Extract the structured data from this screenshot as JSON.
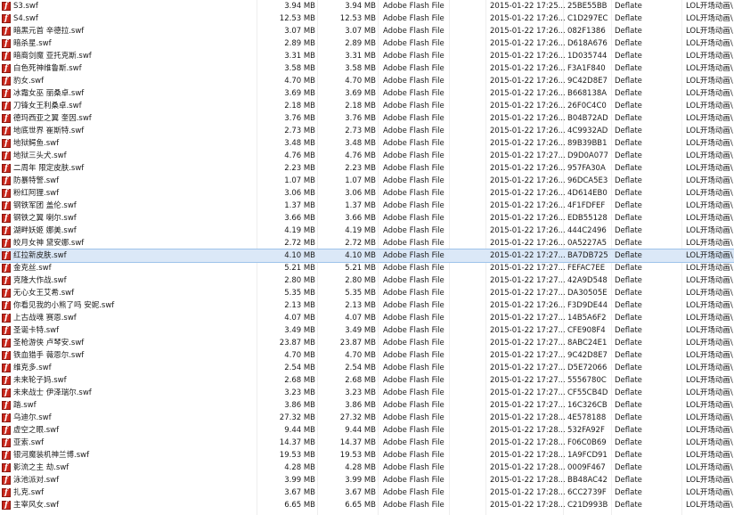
{
  "file_type": "Adobe Flash File",
  "method": "Deflate",
  "folder": "LOL开场动画\\",
  "selected_index": 20,
  "files": [
    {
      "name": "S3.swf",
      "size": "3.94 MB",
      "packed": "3.94 MB",
      "modified": "2015-01-22 17:25...",
      "crc": "25BE55BB"
    },
    {
      "name": "S4.swf",
      "size": "12.53 MB",
      "packed": "12.53 MB",
      "modified": "2015-01-22 17:26...",
      "crc": "C1D297EC"
    },
    {
      "name": "暗黑元首 辛德拉.swf",
      "size": "3.07 MB",
      "packed": "3.07 MB",
      "modified": "2015-01-22 17:26...",
      "crc": "082F1386"
    },
    {
      "name": "暗杀星.swf",
      "size": "2.89 MB",
      "packed": "2.89 MB",
      "modified": "2015-01-22 17:26...",
      "crc": "D618A676"
    },
    {
      "name": "暗裔剑魔 亚托克斯.swf",
      "size": "3.31 MB",
      "packed": "3.31 MB",
      "modified": "2015-01-22 17:26...",
      "crc": "1D035744"
    },
    {
      "name": "白色死神维鲁斯.swf",
      "size": "3.58 MB",
      "packed": "3.58 MB",
      "modified": "2015-01-22 17:26...",
      "crc": "F3A1F840"
    },
    {
      "name": "豹女.swf",
      "size": "4.70 MB",
      "packed": "4.70 MB",
      "modified": "2015-01-22 17:26...",
      "crc": "9C42D8E7"
    },
    {
      "name": "冰霜女巫 丽桑卓.swf",
      "size": "3.69 MB",
      "packed": "3.69 MB",
      "modified": "2015-01-22 17:26...",
      "crc": "B668138A"
    },
    {
      "name": "刀锋女王利桑卓.swf",
      "size": "2.18 MB",
      "packed": "2.18 MB",
      "modified": "2015-01-22 17:26...",
      "crc": "26F0C4C0"
    },
    {
      "name": "德玛西亚之翼 奎因.swf",
      "size": "3.76 MB",
      "packed": "3.76 MB",
      "modified": "2015-01-22 17:26...",
      "crc": "B04B72AD"
    },
    {
      "name": "地底世界 崔斯特.swf",
      "size": "2.73 MB",
      "packed": "2.73 MB",
      "modified": "2015-01-22 17:26...",
      "crc": "4C9932AD"
    },
    {
      "name": "地狱鳄鱼.swf",
      "size": "3.48 MB",
      "packed": "3.48 MB",
      "modified": "2015-01-22 17:26...",
      "crc": "89B39BB1"
    },
    {
      "name": "地狱三头犬.swf",
      "size": "4.76 MB",
      "packed": "4.76 MB",
      "modified": "2015-01-22 17:27...",
      "crc": "D9D0A077"
    },
    {
      "name": "二周年 限定皮肤.swf",
      "size": "2.23 MB",
      "packed": "2.23 MB",
      "modified": "2015-01-22 17:26...",
      "crc": "957FA30A"
    },
    {
      "name": "防暴特警.swf",
      "size": "1.07 MB",
      "packed": "1.07 MB",
      "modified": "2015-01-22 17:26...",
      "crc": "96DCA5E3"
    },
    {
      "name": "粉红阿狸.swf",
      "size": "3.06 MB",
      "packed": "3.06 MB",
      "modified": "2015-01-22 17:26...",
      "crc": "4D614EB0"
    },
    {
      "name": "钢铁军团 盖伦.swf",
      "size": "1.37 MB",
      "packed": "1.37 MB",
      "modified": "2015-01-22 17:26...",
      "crc": "4F1FDFEF"
    },
    {
      "name": "钢铁之翼 喇尔.swf",
      "size": "3.66 MB",
      "packed": "3.66 MB",
      "modified": "2015-01-22 17:26...",
      "crc": "EDB55128"
    },
    {
      "name": "湖畔妖姬 娜美.swf",
      "size": "4.19 MB",
      "packed": "4.19 MB",
      "modified": "2015-01-22 17:26...",
      "crc": "444C2496"
    },
    {
      "name": "皎月女神 黛安娜.swf",
      "size": "2.72 MB",
      "packed": "2.72 MB",
      "modified": "2015-01-22 17:26...",
      "crc": "0A5227A5"
    },
    {
      "name": "红拉新皮肤.swf",
      "size": "4.10 MB",
      "packed": "4.10 MB",
      "modified": "2015-01-22 17:27...",
      "crc": "BA7DB725"
    },
    {
      "name": "金克丝.swf",
      "size": "5.21 MB",
      "packed": "5.21 MB",
      "modified": "2015-01-22 17:27...",
      "crc": "FEFAC7EE"
    },
    {
      "name": "克隆大作战.swf",
      "size": "2.80 MB",
      "packed": "2.80 MB",
      "modified": "2015-01-22 17:27...",
      "crc": "42A9D548"
    },
    {
      "name": "无心女王艾希.swf",
      "size": "5.35 MB",
      "packed": "5.35 MB",
      "modified": "2015-01-22 17:27...",
      "crc": "DA30505E"
    },
    {
      "name": "你看见我的小熊了吗 安妮.swf",
      "size": "2.13 MB",
      "packed": "2.13 MB",
      "modified": "2015-01-22 17:26...",
      "crc": "F3D9DE44"
    },
    {
      "name": "上古战魂 赛恩.swf",
      "size": "4.07 MB",
      "packed": "4.07 MB",
      "modified": "2015-01-22 17:27...",
      "crc": "14B5A6F2"
    },
    {
      "name": "圣诞卡特.swf",
      "size": "3.49 MB",
      "packed": "3.49 MB",
      "modified": "2015-01-22 17:27...",
      "crc": "CFE908F4"
    },
    {
      "name": "圣枪游侠 卢琴安.swf",
      "size": "23.87 MB",
      "packed": "23.87 MB",
      "modified": "2015-01-22 17:27...",
      "crc": "8ABC24E1"
    },
    {
      "name": "铁血猎手 薇恩尔.swf",
      "size": "4.70 MB",
      "packed": "4.70 MB",
      "modified": "2015-01-22 17:27...",
      "crc": "9C42D8E7"
    },
    {
      "name": "维克多.swf",
      "size": "2.54 MB",
      "packed": "2.54 MB",
      "modified": "2015-01-22 17:27...",
      "crc": "D5E72066"
    },
    {
      "name": "未来轮子妈.swf",
      "size": "2.68 MB",
      "packed": "2.68 MB",
      "modified": "2015-01-22 17:27...",
      "crc": "5556780C"
    },
    {
      "name": "未来战士 伊泽瑞尔.swf",
      "size": "3.23 MB",
      "packed": "3.23 MB",
      "modified": "2015-01-22 17:27...",
      "crc": "CF55CB4D"
    },
    {
      "name": "踏.swf",
      "size": "3.86 MB",
      "packed": "3.86 MB",
      "modified": "2015-01-22 17:27...",
      "crc": "16C326CB"
    },
    {
      "name": "乌迪尔.swf",
      "size": "27.32 MB",
      "packed": "27.32 MB",
      "modified": "2015-01-22 17:28...",
      "crc": "4E578188"
    },
    {
      "name": "虚空之眼.swf",
      "size": "9.44 MB",
      "packed": "9.44 MB",
      "modified": "2015-01-22 17:28...",
      "crc": "532FA92F"
    },
    {
      "name": "亚索.swf",
      "size": "14.37 MB",
      "packed": "14.37 MB",
      "modified": "2015-01-22 17:28...",
      "crc": "F06C0B69"
    },
    {
      "name": "银河魔装机神兰博.swf",
      "size": "19.53 MB",
      "packed": "19.53 MB",
      "modified": "2015-01-22 17:28...",
      "crc": "1A9FCD91"
    },
    {
      "name": "影流之主 劫.swf",
      "size": "4.28 MB",
      "packed": "4.28 MB",
      "modified": "2015-01-22 17:28...",
      "crc": "0009F467"
    },
    {
      "name": "泳池派对.swf",
      "size": "3.99 MB",
      "packed": "3.99 MB",
      "modified": "2015-01-22 17:28...",
      "crc": "BB48AC42"
    },
    {
      "name": "扎克.swf",
      "size": "3.67 MB",
      "packed": "3.67 MB",
      "modified": "2015-01-22 17:28...",
      "crc": "6CC2739F"
    },
    {
      "name": "主宰风女.swf",
      "size": "6.65 MB",
      "packed": "6.65 MB",
      "modified": "2015-01-22 17:28...",
      "crc": "C21D993B"
    }
  ]
}
